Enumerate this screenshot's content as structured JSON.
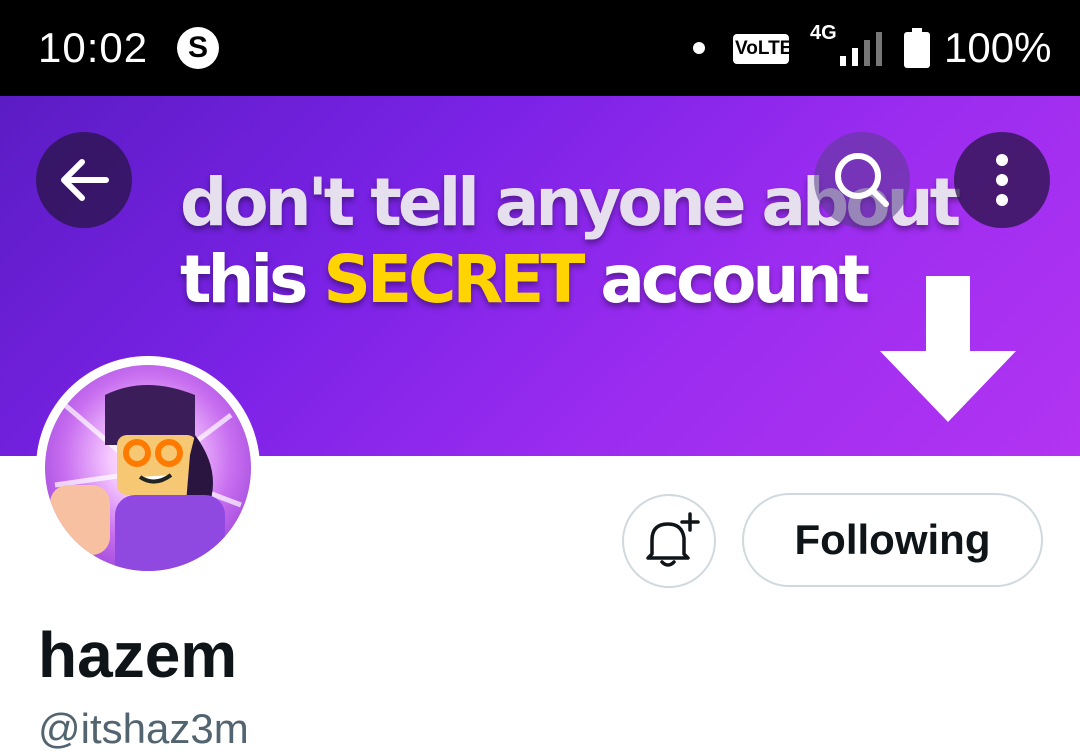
{
  "status_bar": {
    "time": "10:02",
    "app_icon_letter": "S",
    "volte_label": "VoLTE",
    "network": "4G",
    "battery": "100%"
  },
  "banner": {
    "line1": "don't tell anyone about",
    "line2_pre": "this ",
    "line2_highlight": "SECRET",
    "line2_post": " account",
    "highlight_color": "#ffd400"
  },
  "header_icons": {
    "back": "back-arrow-icon",
    "search": "search-icon",
    "more": "more-vertical-icon"
  },
  "profile": {
    "display_name": "hazem",
    "handle": "@itshaz3m",
    "follow_state_label": "Following",
    "notify_icon": "bell-plus-icon"
  }
}
